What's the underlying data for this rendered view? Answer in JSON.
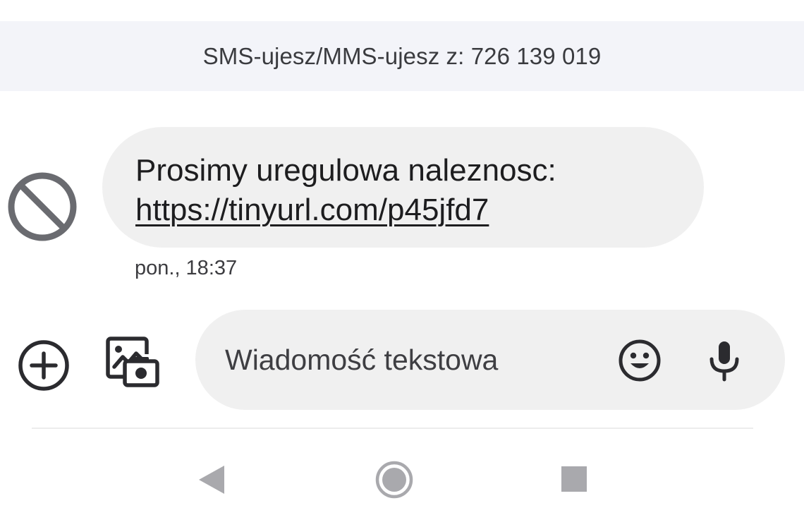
{
  "header": {
    "sender_label": "SMS-ujesz/MMS-ujesz z: 726 139 019"
  },
  "conversation": {
    "sender_icon": "blocked-icon",
    "messages": [
      {
        "text": "Prosimy uregulowa naleznosc:",
        "link": "https://tinyurl.com/p45jfd7",
        "timestamp": "pon., 18:37"
      }
    ]
  },
  "composer": {
    "add_icon": "add-circle-icon",
    "gallery_icon": "gallery-camera-icon",
    "placeholder": "Wiadomość tekstowa",
    "emoji_icon": "emoji-icon",
    "mic_icon": "microphone-icon"
  },
  "navbar": {
    "icons": [
      "back-icon",
      "home-icon",
      "recents-icon"
    ]
  },
  "colors": {
    "banner_bg": "#f3f4f9",
    "bubble_bg": "#f0f0f0",
    "icon_dark": "#2b2b2f",
    "nav_gray": "#a9a9ad"
  }
}
